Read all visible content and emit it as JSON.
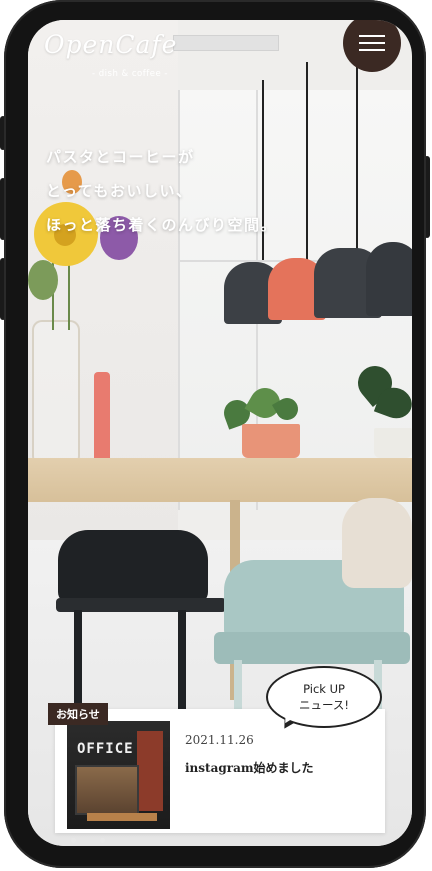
{
  "brand": {
    "name": "OpenCafe",
    "tagline": "- dish & coffee -"
  },
  "nav": {
    "menu_icon": "hamburger-icon"
  },
  "hero": {
    "catch_lines": [
      "パスタとコーヒーが",
      "とってもおいしい、",
      "ほっと落ち着くのんびり空間。"
    ]
  },
  "pickup": {
    "line1": "Pick UP",
    "line2": "ニュース!"
  },
  "news": {
    "badge": "お知らせ",
    "date": "2021.11.26",
    "title": "instagram始めました",
    "thumb_sign": "OFFICE"
  },
  "colors": {
    "accent": "#3b2923",
    "frame": "#141414",
    "lamp_dark": "#3c4045",
    "lamp_coral": "#e4735b",
    "chair_teal": "#a9c7c4"
  }
}
